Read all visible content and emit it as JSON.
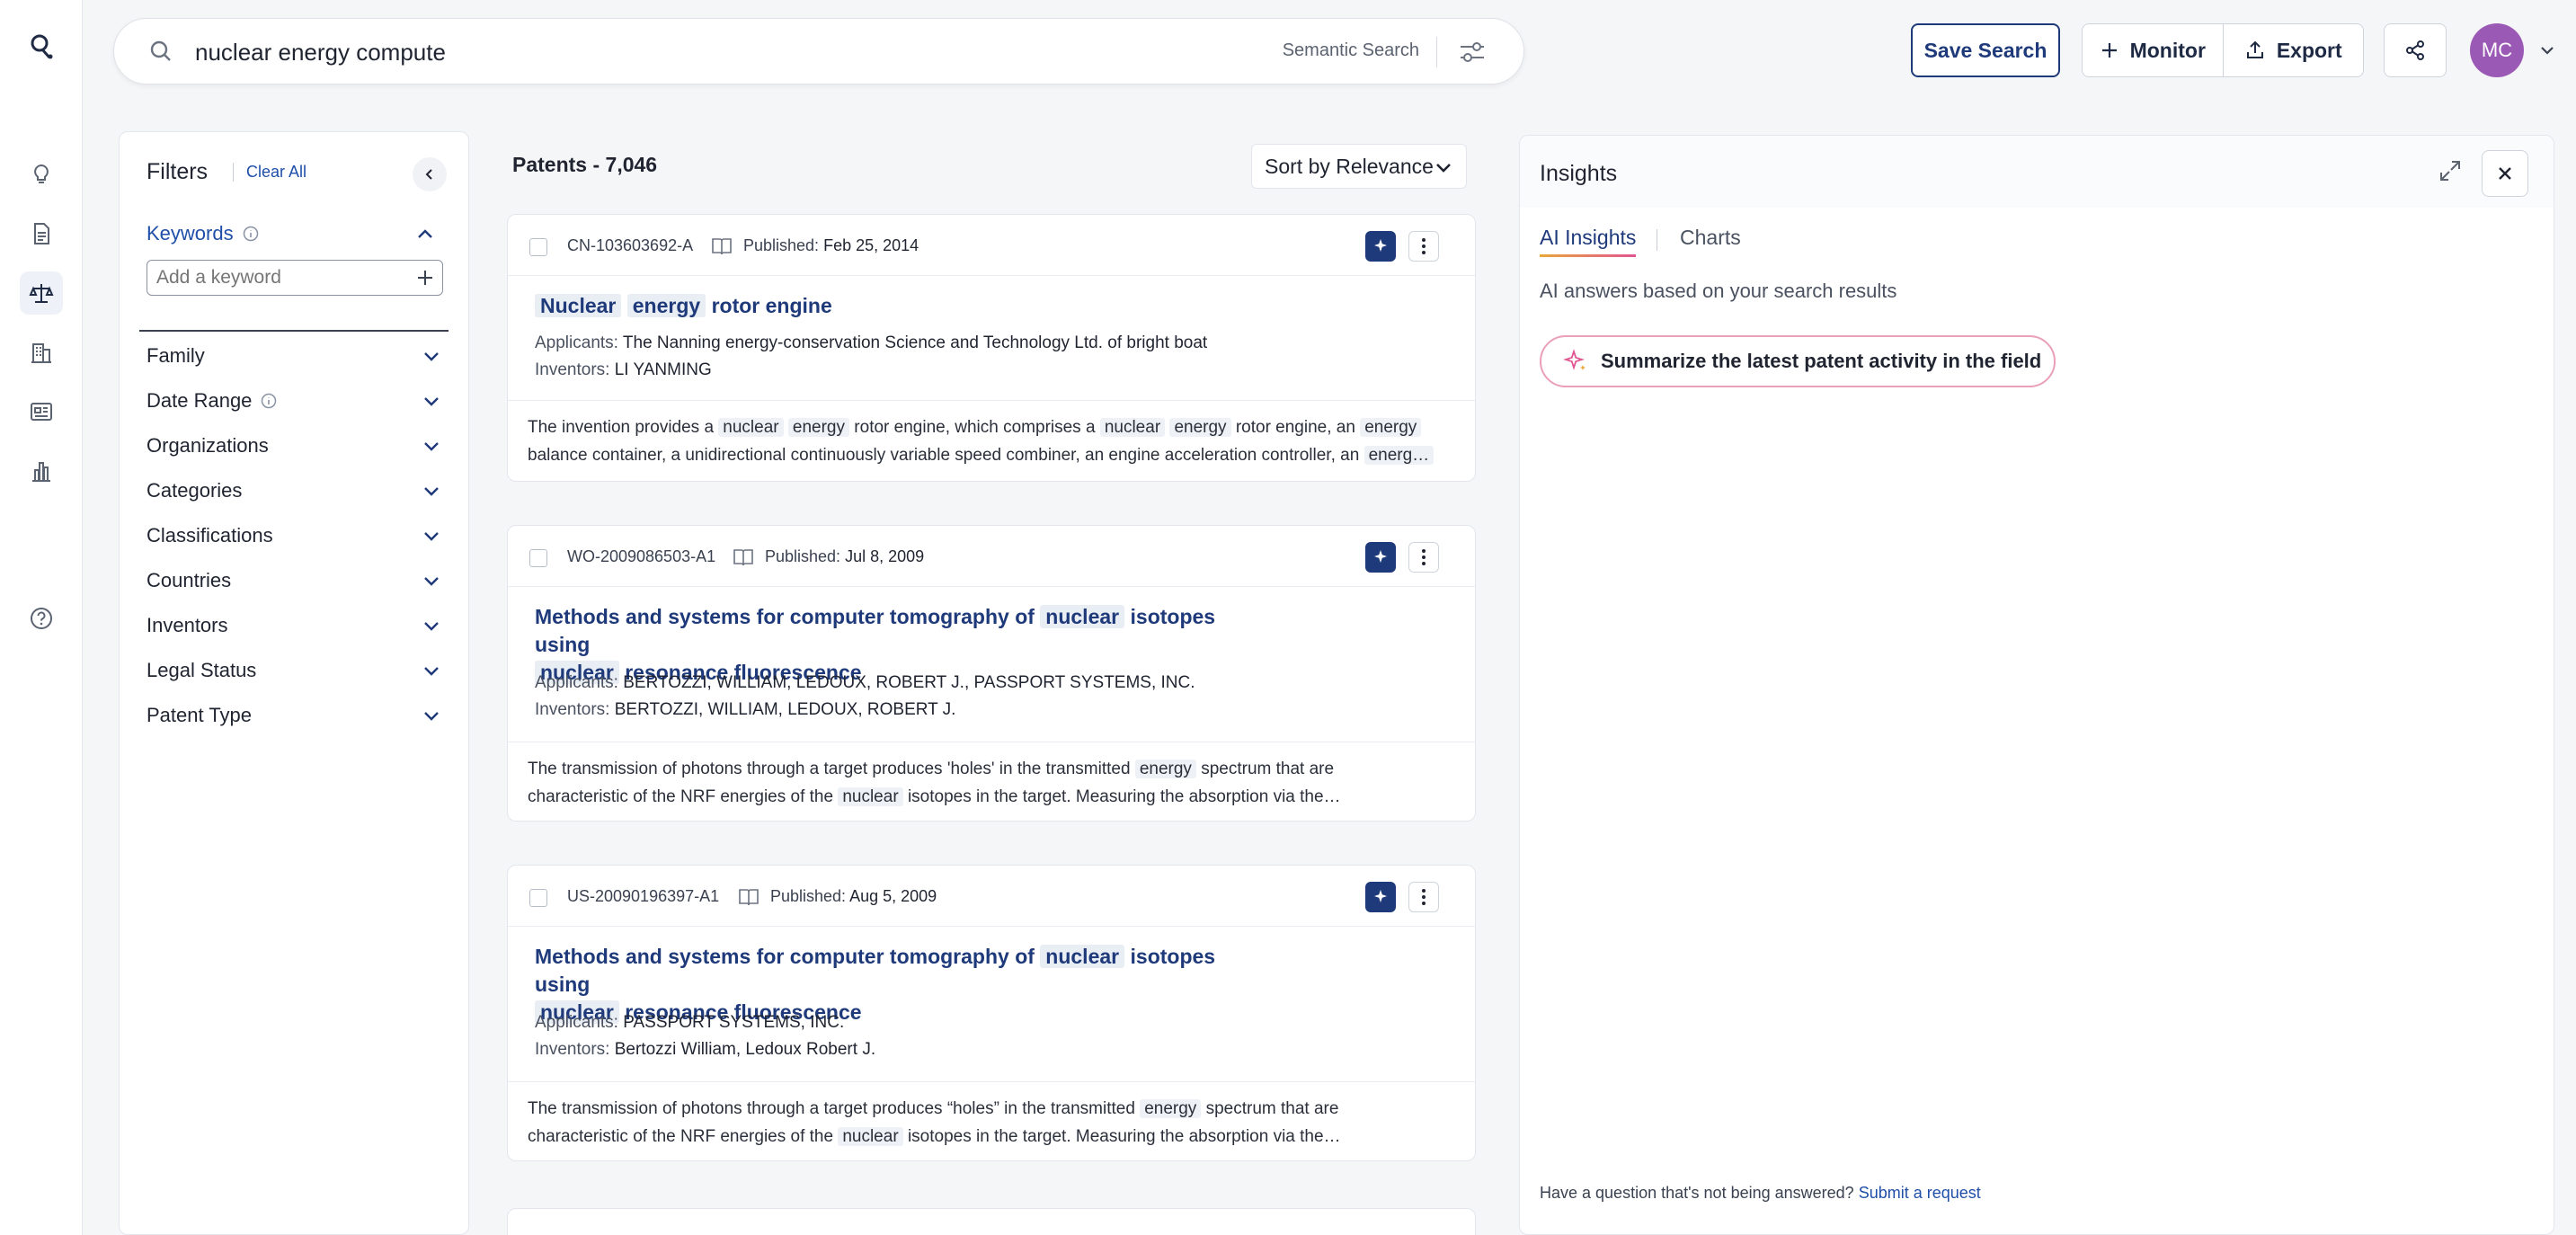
{
  "search": {
    "query": "nuclear energy compute",
    "mode_label": "Semantic Search"
  },
  "toolbar": {
    "save_label": "Save Search",
    "monitor_label": "Monitor",
    "export_label": "Export"
  },
  "user": {
    "initials": "MC"
  },
  "filters": {
    "title": "Filters",
    "clear_all": "Clear All",
    "keywords_label": "Keywords",
    "keyword_placeholder": "Add a keyword",
    "facets": [
      {
        "label": "Family"
      },
      {
        "label": "Date Range"
      },
      {
        "label": "Organizations"
      },
      {
        "label": "Categories"
      },
      {
        "label": "Classifications"
      },
      {
        "label": "Countries"
      },
      {
        "label": "Inventors"
      },
      {
        "label": "Legal Status"
      },
      {
        "label": "Patent Type"
      }
    ]
  },
  "results": {
    "header": "Patents - 7,046",
    "sort_label": "Sort by Relevance",
    "published_label": "Published:",
    "applicants_label": "Applicants:",
    "inventors_label": "Inventors:",
    "items": [
      {
        "number": "CN-103603692-A",
        "published": "Feb 25, 2014",
        "title_parts": [
          "Nuclear",
          "energy",
          "rotor engine"
        ],
        "applicants": "The Nanning energy-conservation Science and Technology Ltd. of bright boat",
        "inventors": "LI YANMING",
        "abstract": {
          "a": "The invention provides a",
          "b": "nuclear",
          "c": "energy",
          "d": "rotor engine, which comprises a",
          "e": "nuclear",
          "f": "energy",
          "g": "rotor engine, an",
          "h": "energy",
          "i": "balance container, a unidirectional continuously variable speed combiner, an engine acceleration controller, an",
          "j": "energ…"
        }
      },
      {
        "number": "WO-2009086503-A1",
        "published": "Jul 8, 2009",
        "title_parts": [
          "Methods and systems for computer tomography of",
          "nuclear",
          "isotopes using",
          "nuclear",
          "resonance fluorescence"
        ],
        "applicants": "BERTOZZI, WILLIAM, LEDOUX, ROBERT J., PASSPORT SYSTEMS, INC.",
        "inventors": "BERTOZZI, WILLIAM, LEDOUX, ROBERT J.",
        "abstract": {
          "a": "The transmission of photons through a target produces 'holes' in the transmitted",
          "b": "energy",
          "c": "spectrum that are",
          "d": "characteristic of the NRF energies of the",
          "e": "nuclear",
          "f": "isotopes in the target. Measuring the absorption via the…"
        }
      },
      {
        "number": "US-20090196397-A1",
        "published": "Aug 5, 2009",
        "title_parts": [
          "Methods and systems for computer tomography of",
          "nuclear",
          "isotopes using",
          "nuclear",
          "resonance fluorescence"
        ],
        "applicants": "PASSPORT SYSTEMS, INC.",
        "inventors": "Bertozzi William, Ledoux Robert J.",
        "abstract": {
          "a": "The transmission of photons through a target produces “holes” in the transmitted",
          "b": "energy",
          "c": "spectrum that are",
          "d": "characteristic of the NRF energies of the",
          "e": "nuclear",
          "f": "isotopes in the target. Measuring the absorption via the…"
        }
      }
    ]
  },
  "insights": {
    "title": "Insights",
    "tab_ai": "AI Insights",
    "tab_charts": "Charts",
    "subtitle": "AI answers based on your search results",
    "suggestion": "Summarize the latest patent activity in the field",
    "footer_text": "Have a question that's not being answered?",
    "footer_link": "Submit a request"
  },
  "colors": {
    "brand": "#1f3a7a",
    "link": "#1f4fa8",
    "avatar": "#9b59b6"
  }
}
